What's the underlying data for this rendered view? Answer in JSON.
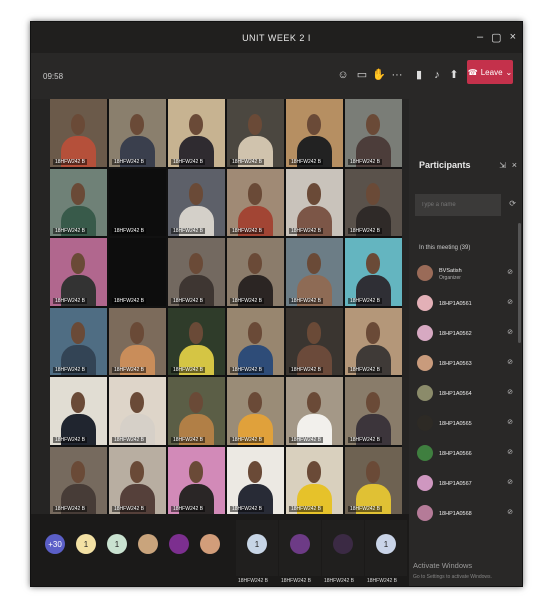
{
  "window": {
    "title": "UNIT WEEK 2 I"
  },
  "toolbar": {
    "timer": "09:58",
    "leave_label": "Leave"
  },
  "grid": {
    "tiles": [
      {
        "label": "18HFW242 B",
        "bg": "#6b5a4a",
        "body": "#b5503a"
      },
      {
        "label": "18HFW242 B",
        "bg": "#8a7f6d",
        "body": "#3a3f4d"
      },
      {
        "label": "18HFW242 B",
        "bg": "#c7b391",
        "body": "#2f2b30"
      },
      {
        "label": "18HFW242 B",
        "bg": "#4b4740",
        "body": "#d0c3ad"
      },
      {
        "label": "18HFW242 B",
        "bg": "#b68f62",
        "body": "#222"
      },
      {
        "label": "18HFW242 B",
        "bg": "#7a7d77",
        "body": "#4c3d3a"
      },
      {
        "label": "18HFW242 B",
        "bg": "#6f8177",
        "body": "#385a4a"
      },
      {
        "label": "18HFW242 B",
        "bg": "#0d0d0d",
        "body": "#0d0d0d"
      },
      {
        "label": "18HFW242 B",
        "bg": "#5d6069",
        "body": "#d4d0c9"
      },
      {
        "label": "18HFW242 B",
        "bg": "#a08a75",
        "body": "#a24534"
      },
      {
        "label": "18HFW242 B",
        "bg": "#c9c3bb",
        "body": "#7c5647"
      },
      {
        "label": "18HFW242 B",
        "bg": "#5a524b",
        "body": "#2f2a28"
      },
      {
        "label": "18HFW242 B",
        "bg": "#b1678e",
        "body": "#333"
      },
      {
        "label": "18HFW242 B",
        "bg": "#0d0d0d",
        "body": "#0d0d0d"
      },
      {
        "label": "18HFW242 B",
        "bg": "#736960",
        "body": "#3e3632"
      },
      {
        "label": "18HFW242 B",
        "bg": "#8b7c6b",
        "body": "#2b2523"
      },
      {
        "label": "18HFW242 B",
        "bg": "#6c7d86",
        "body": "#8e6b55"
      },
      {
        "label": "18HFW242 B",
        "bg": "#64b5c0",
        "body": "#2f2f35"
      },
      {
        "label": "18HFW242 B",
        "bg": "#4f6d83",
        "body": "#345"
      },
      {
        "label": "18HFW242 B",
        "bg": "#7c6b5b",
        "body": "#c98d5a"
      },
      {
        "label": "18HFW242 B",
        "bg": "#2f3c2a",
        "body": "#d5c544"
      },
      {
        "label": "18HFW242 B",
        "bg": "#98866f",
        "body": "#2e4c78"
      },
      {
        "label": "18HFW242 B",
        "bg": "#3a3530",
        "body": "#6b4a3a"
      },
      {
        "label": "18HFW242 B",
        "bg": "#b49779",
        "body": "#3f3a37"
      },
      {
        "label": "18HFW242 B",
        "bg": "#e1ddd3",
        "body": "#20252f"
      },
      {
        "label": "18HFW242 B",
        "bg": "#ded5c9",
        "body": "#d6d0c8"
      },
      {
        "label": "18HFW242 B",
        "bg": "#5b5e46",
        "body": "#b17f46"
      },
      {
        "label": "18HFW242 B",
        "bg": "#9a8c77",
        "body": "#e0a13b"
      },
      {
        "label": "18HFW242 B",
        "bg": "#a49887",
        "body": "#f2f0ec"
      },
      {
        "label": "18HFW242 B",
        "bg": "#897c6a",
        "body": "#3c353b"
      },
      {
        "label": "18HFW242 B",
        "bg": "#766a5e",
        "body": "#473c37"
      },
      {
        "label": "18HFW242 B",
        "bg": "#b8aea1",
        "body": "#55403a"
      },
      {
        "label": "18HFW242 B",
        "bg": "#d28ab8",
        "body": "#2a2626"
      },
      {
        "label": "18HFW242 B",
        "bg": "#ece9e3",
        "body": "#282b36"
      },
      {
        "label": "18HFW242 B",
        "bg": "#d9d0be",
        "body": "#e6c22a"
      },
      {
        "label": "18HFW242 B",
        "bg": "#6e6252",
        "body": "#e0c134"
      }
    ]
  },
  "bottom": {
    "avatars": [
      {
        "text": "+30",
        "color": "#5b5fc7"
      },
      {
        "text": "1",
        "color": "#f3e1a4"
      },
      {
        "text": "1",
        "color": "#c9e2d0"
      },
      {
        "text": "",
        "color": "#c9a47c"
      },
      {
        "text": "",
        "color": "#7c2f8f"
      },
      {
        "text": "",
        "color": "#d29d7a"
      }
    ],
    "tiles": [
      {
        "label": "18HFW242 B",
        "avatar": "1",
        "avcolor": "#c7d5e6"
      },
      {
        "label": "18HFW242 B",
        "avatar": "",
        "avcolor": "#6d3b86"
      },
      {
        "label": "18HFW242 B",
        "avatar": "",
        "avcolor": "#3b2a44"
      },
      {
        "label": "18HFW242 B",
        "avatar": "1",
        "avcolor": "#c9d4e8"
      }
    ]
  },
  "participants": {
    "title": "Participants",
    "search_placeholder": "Type a name",
    "in_meeting": "In this meeting (39)",
    "list": [
      {
        "name": "BVSatish",
        "role": "Organizer",
        "color": "#9a6b58"
      },
      {
        "name": "18HP1A0561",
        "role": "",
        "color": "#e3b0b7"
      },
      {
        "name": "18HP1A0562",
        "role": "",
        "color": "#d7a9c2"
      },
      {
        "name": "18HP1A0563",
        "role": "",
        "color": "#c99b7c"
      },
      {
        "name": "18HP1A0564",
        "role": "",
        "color": "#8b8b6a"
      },
      {
        "name": "18HP1A0565",
        "role": "",
        "color": "#2d2a25"
      },
      {
        "name": "18HP1A0566",
        "role": "",
        "color": "#3f7f3f"
      },
      {
        "name": "18HP1A0567",
        "role": "",
        "color": "#cf97c0"
      },
      {
        "name": "18HP1A0568",
        "role": "",
        "color": "#b57b98"
      }
    ],
    "watermark": "Activate Windows",
    "watermark_sub": "Go to Settings to activate Windows."
  }
}
